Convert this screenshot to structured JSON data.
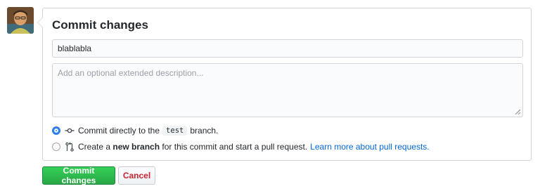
{
  "avatar": {
    "icon": "user-avatar-photo"
  },
  "form": {
    "title": "Commit changes",
    "summary_value": "blablabla",
    "description_placeholder": "Add an optional extended description..."
  },
  "options": {
    "direct": {
      "selected": true,
      "icon": "git-commit-icon",
      "text_before": "Commit directly to the",
      "branch": "test",
      "text_after": "branch."
    },
    "new_branch": {
      "selected": false,
      "icon": "git-pull-request-icon",
      "text_before": "Create a",
      "bold": "new branch",
      "text_after": "for this commit and start a pull request.",
      "link": "Learn more about pull requests."
    }
  },
  "buttons": {
    "commit": "Commit changes",
    "cancel": "Cancel"
  },
  "colors": {
    "primary": "#28a745",
    "danger": "#cb2431",
    "link": "#0366d6",
    "radio": "#2f80ed"
  }
}
